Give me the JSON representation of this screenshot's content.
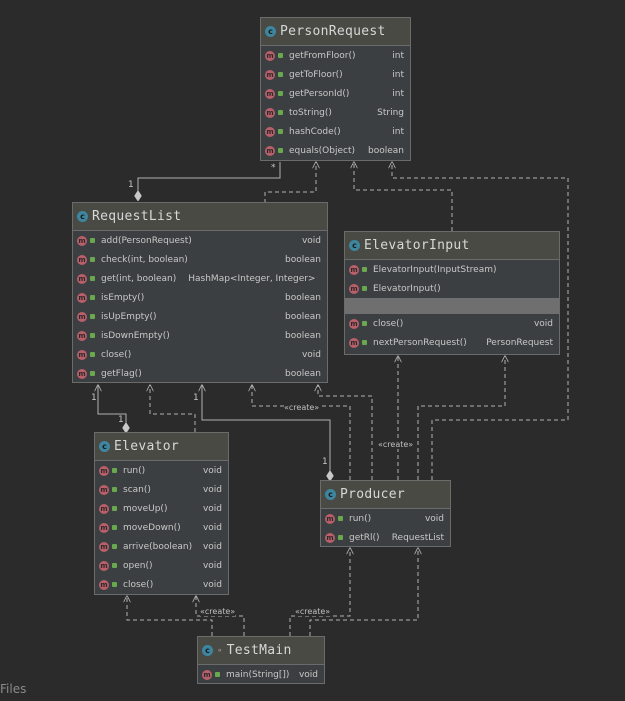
{
  "classes": {
    "person_request": {
      "title": "PersonRequest",
      "methods": [
        {
          "name": "getFromFloor()",
          "type": "int"
        },
        {
          "name": "getToFloor()",
          "type": "int"
        },
        {
          "name": "getPersonId()",
          "type": "int"
        },
        {
          "name": "toString()",
          "type": "String"
        },
        {
          "name": "hashCode()",
          "type": "int"
        },
        {
          "name": "equals(Object)",
          "type": "boolean"
        }
      ]
    },
    "request_list": {
      "title": "RequestList",
      "methods": [
        {
          "name": "add(PersonRequest)",
          "type": "void"
        },
        {
          "name": "check(int, boolean)",
          "type": "boolean"
        },
        {
          "name": "get(int, boolean)",
          "type": "HashMap<Integer, Integer>"
        },
        {
          "name": "isEmpty()",
          "type": "boolean"
        },
        {
          "name": "isUpEmpty()",
          "type": "boolean"
        },
        {
          "name": "isDownEmpty()",
          "type": "boolean"
        },
        {
          "name": "close()",
          "type": "void"
        },
        {
          "name": "getFlag()",
          "type": "boolean"
        }
      ]
    },
    "elevator_input": {
      "title": "ElevatorInput",
      "constructors": [
        {
          "name": "ElevatorInput(InputStream)",
          "type": ""
        },
        {
          "name": "ElevatorInput()",
          "type": ""
        }
      ],
      "methods": [
        {
          "name": "close()",
          "type": "void"
        },
        {
          "name": "nextPersonRequest()",
          "type": "PersonRequest"
        }
      ]
    },
    "elevator": {
      "title": "Elevator",
      "methods": [
        {
          "name": "run()",
          "type": "void"
        },
        {
          "name": "scan()",
          "type": "void"
        },
        {
          "name": "moveUp()",
          "type": "void"
        },
        {
          "name": "moveDown()",
          "type": "void"
        },
        {
          "name": "arrive(boolean)",
          "type": "void"
        },
        {
          "name": "open()",
          "type": "void"
        },
        {
          "name": "close()",
          "type": "void"
        }
      ]
    },
    "producer": {
      "title": "Producer",
      "methods": [
        {
          "name": "run()",
          "type": "void"
        },
        {
          "name": "getRl()",
          "type": "RequestList"
        }
      ]
    },
    "test_main": {
      "title": "TestMain",
      "methods": [
        {
          "name": "main(String[])",
          "type": "void"
        }
      ]
    }
  },
  "edge_labels": {
    "create": "«create»",
    "one": "1",
    "many": "*"
  },
  "panel": {
    "files_label": "Files"
  },
  "colors": {
    "background": "#2b2b2b",
    "class_fill": "#3c3f41",
    "header_fill": "#4a4a44",
    "class_icon": "#3e86a0",
    "method_icon": "#b95f6a",
    "public_lock": "#6aa84f",
    "edge": "#b0b0b0"
  }
}
